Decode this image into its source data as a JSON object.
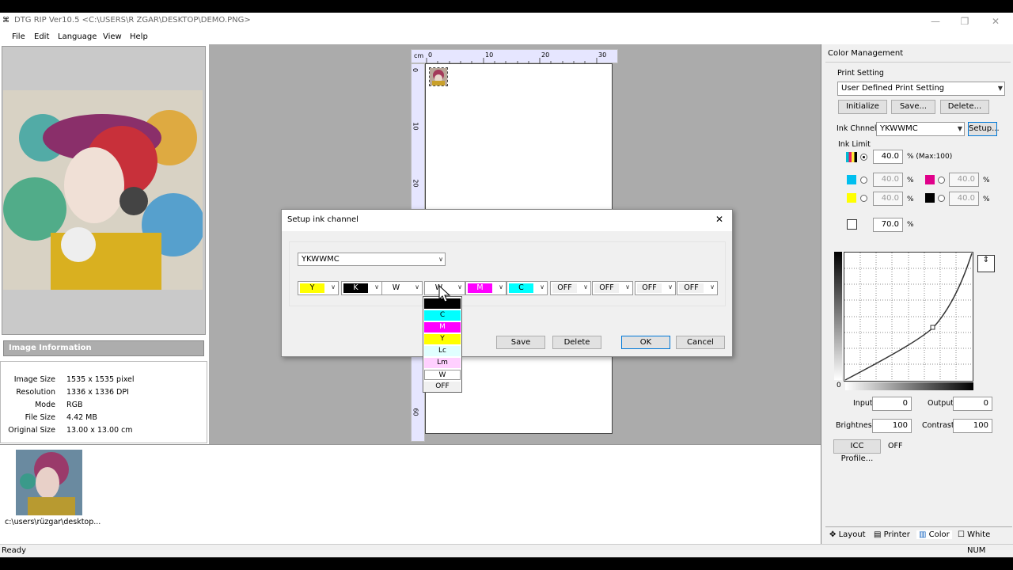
{
  "window": {
    "title": "DTG RIP Ver10.5 <C:\\USERS\\R  ZGAR\\DESKTOP\\DEMO.PNG>",
    "min": "—",
    "max": "❐",
    "close": "✕"
  },
  "menu": {
    "items": [
      {
        "label": "File"
      },
      {
        "label": "Edit"
      },
      {
        "label": "Language"
      },
      {
        "label": "View"
      },
      {
        "label": "Help"
      }
    ]
  },
  "image_info": {
    "header": "Image Information",
    "rows": [
      {
        "label": "Image Size",
        "value": "1535 x 1535 pixel"
      },
      {
        "label": "Resolution",
        "value": "1336 x 1336 DPI"
      },
      {
        "label": "Mode",
        "value": "RGB"
      },
      {
        "label": "File Size",
        "value": "4.42 MB"
      },
      {
        "label": "Original Size",
        "value": "13.00 x 13.00 cm"
      }
    ]
  },
  "ruler": {
    "unit": "cm",
    "top_ticks": [
      "0",
      "10",
      "20",
      "30"
    ],
    "left_ticks": [
      "0",
      "10",
      "20",
      "60"
    ]
  },
  "thumbnail": {
    "caption": "c:\\users\\rüzgar\\desktop..."
  },
  "color_mgmt": {
    "title": "Color Management",
    "print_setting": {
      "label": "Print Setting",
      "value": "User Defined Print Setting",
      "buttons": [
        "Initialize",
        "Save...",
        "Delete..."
      ]
    },
    "ink_channel": {
      "label": "Ink Chnnel",
      "value": "YKWWMC",
      "setup": "Setup..."
    },
    "ink_limit": {
      "label": "Ink Limit",
      "all": "40.0",
      "max_note": "% (Max:100)",
      "c": "40.0",
      "m": "40.0",
      "y": "40.0",
      "k": "40.0",
      "pct": "%",
      "white": "70.0"
    },
    "curve": {
      "zero": "0",
      "input_label": "Input",
      "input_value": "0",
      "output_label": "Output",
      "output_value": "0",
      "brightness_label": "Brightness",
      "brightness_value": "100",
      "contrast_label": "Contrast",
      "contrast_value": "100"
    },
    "icc": {
      "button": "ICC Profile...",
      "value": "OFF"
    },
    "tabs": [
      "Layout",
      "Printer",
      "Color",
      "White"
    ]
  },
  "status": {
    "left": "Ready",
    "right": "NUM"
  },
  "dialog": {
    "title": "Setup ink channel",
    "close": "✕",
    "preset": "YKWWMC",
    "channels": [
      {
        "label": "Y",
        "bg": "#ffff00",
        "fg": "#000"
      },
      {
        "label": "K",
        "bg": "#000000",
        "fg": "#fff"
      },
      {
        "label": "W",
        "bg": "#ffffff",
        "fg": "#000"
      },
      {
        "label": "W",
        "bg": "#ffffff",
        "fg": "#000"
      },
      {
        "label": "M",
        "bg": "#ff00ff",
        "fg": "#fff"
      },
      {
        "label": "C",
        "bg": "#00ffff",
        "fg": "#000"
      },
      {
        "label": "OFF",
        "bg": "#f0f0f0",
        "fg": "#000"
      },
      {
        "label": "OFF",
        "bg": "#f0f0f0",
        "fg": "#000"
      },
      {
        "label": "OFF",
        "bg": "#f0f0f0",
        "fg": "#000"
      },
      {
        "label": "OFF",
        "bg": "#f0f0f0",
        "fg": "#000"
      }
    ],
    "dropdown": [
      {
        "label": "K",
        "bg": "#000000",
        "fg": "#000"
      },
      {
        "label": "C",
        "bg": "#00ffff",
        "fg": "#000"
      },
      {
        "label": "M",
        "bg": "#ff00ff",
        "fg": "#fff"
      },
      {
        "label": "Y",
        "bg": "#ffff00",
        "fg": "#000"
      },
      {
        "label": "Lc",
        "bg": "#e0ffff",
        "fg": "#000"
      },
      {
        "label": "Lm",
        "bg": "#ffd0ff",
        "fg": "#000"
      },
      {
        "label": "W",
        "bg": "#ffffff",
        "fg": "#000"
      },
      {
        "label": "OFF",
        "bg": "#f0f0f0",
        "fg": "#000"
      }
    ],
    "buttons": {
      "save": "Save",
      "delete": "Delete",
      "ok": "OK",
      "cancel": "Cancel"
    }
  }
}
